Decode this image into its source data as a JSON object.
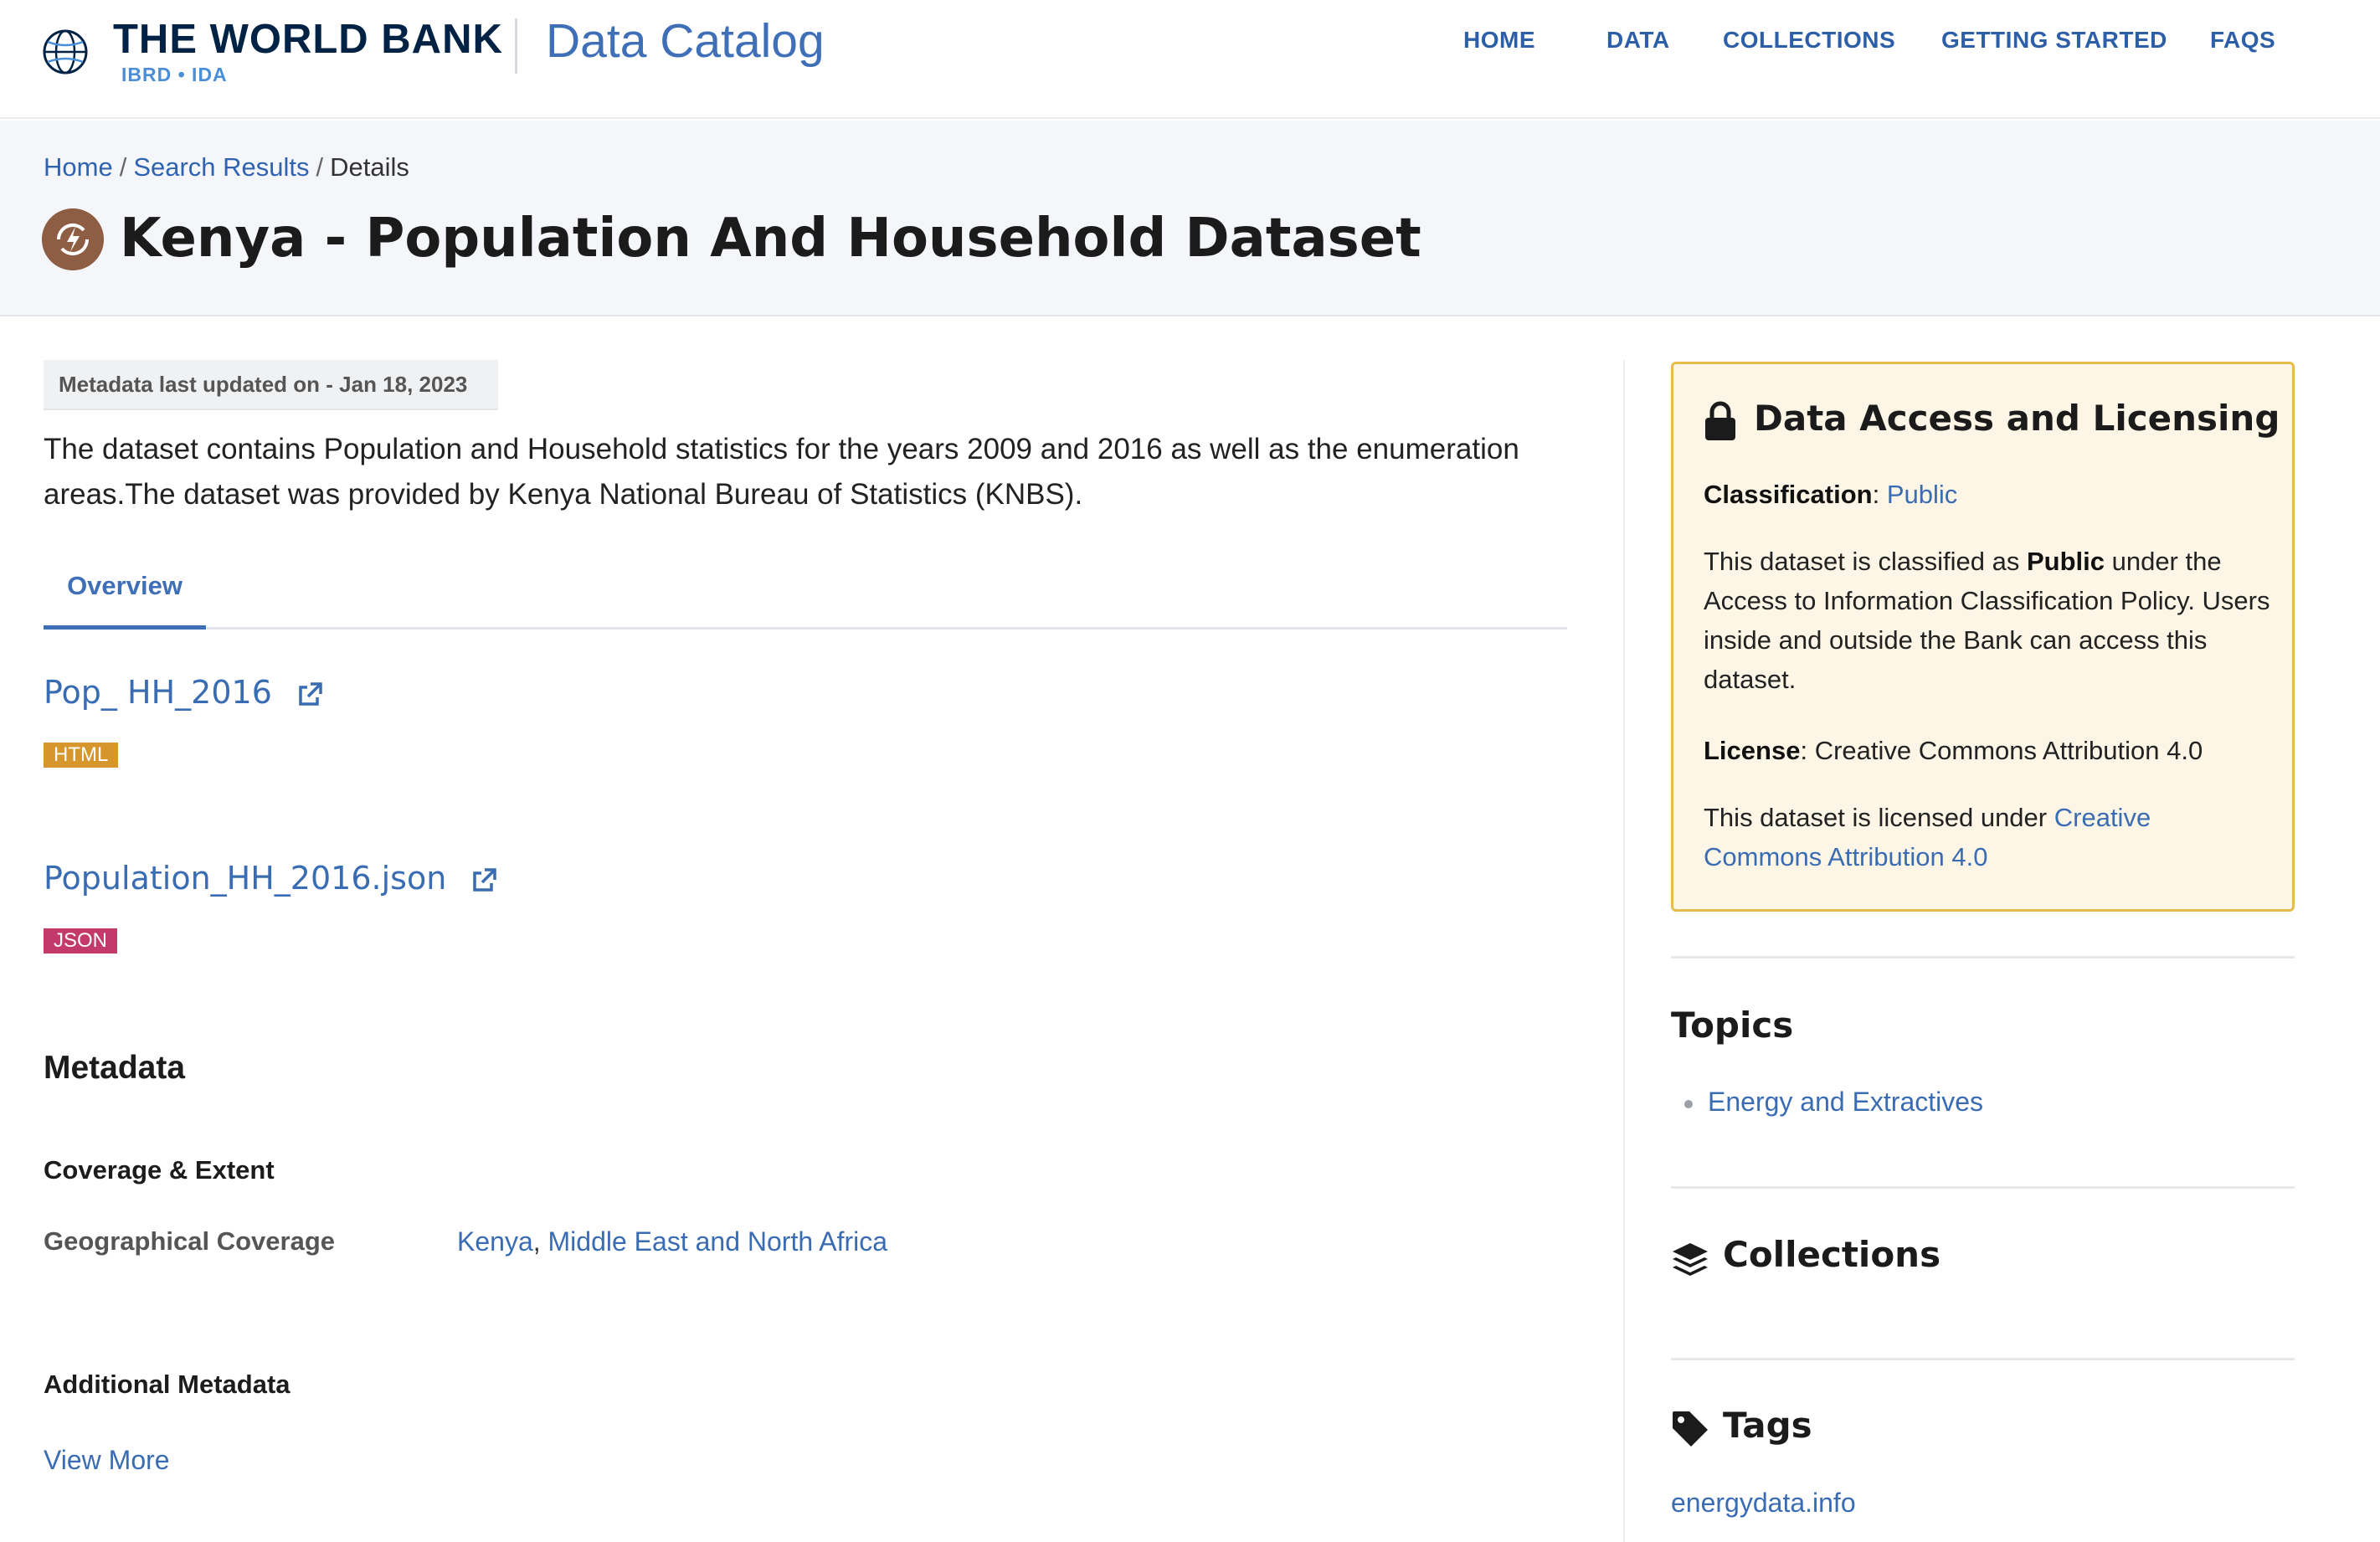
{
  "header": {
    "brand_name": "THE WORLD BANK",
    "brand_sub": "IBRD • IDA",
    "catalog_title": "Data Catalog",
    "nav": [
      "HOME",
      "DATA",
      "COLLECTIONS",
      "GETTING STARTED",
      "FAQS"
    ]
  },
  "breadcrumb": {
    "home": "Home",
    "search": "Search Results",
    "current": "Details",
    "sep": "/"
  },
  "page": {
    "title": "Kenya - Population And Household Dataset",
    "icon": "energy-bolt-icon"
  },
  "dataset": {
    "updated": "Metadata last updated on - Jan 18, 2023",
    "description": "The dataset contains Population and Household statistics for the years 2009 and 2016 as well as the enumeration areas.The dataset was provided by Kenya National Bureau of Statistics (KNBS).",
    "tab_overview": "Overview",
    "resources": [
      {
        "name": "Pop_ HH_2016",
        "format": "HTML"
      },
      {
        "name": "Population_HH_2016.json",
        "format": "JSON"
      }
    ]
  },
  "metadata": {
    "heading": "Metadata",
    "coverage_heading": "Coverage & Extent",
    "geo_label": "Geographical Coverage",
    "geo_values": [
      "Kenya",
      "Middle East and North Africa"
    ],
    "geo_sep": ",",
    "additional_heading": "Additional Metadata",
    "view_more": "View More"
  },
  "access": {
    "title": "Data Access and Licensing",
    "classification_label": "Classification",
    "classification_value": "Public",
    "classified_pre": "This dataset is classified as",
    "classified_bold": "Public",
    "classified_post": "under the Access to Information Classification Policy. Users inside and outside the Bank can access this dataset.",
    "license_label": "License",
    "license_value": "Creative Commons Attribution 4.0",
    "licensed_pre": "This dataset is licensed under",
    "licensed_link": "Creative Commons Attribution 4.0",
    "colon": ":"
  },
  "sidebar": {
    "topics_heading": "Topics",
    "topics": [
      "Energy and Extractives"
    ],
    "collections_heading": "Collections",
    "tags_heading": "Tags",
    "tags": [
      "energydata.info"
    ]
  },
  "colors": {
    "brand_navy": "#002244",
    "link_blue": "#3a6cb3",
    "badge_html": "#d6962c",
    "badge_json": "#c33a6a",
    "access_bg": "#fdf6e6",
    "access_border": "#e9bc4a"
  }
}
